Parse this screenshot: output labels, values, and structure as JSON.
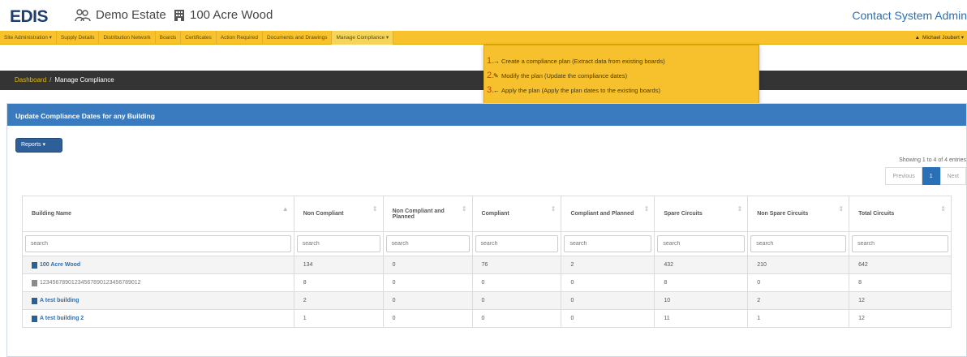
{
  "header": {
    "logo": {
      "first": "E",
      "rest": "DIS"
    },
    "estate_label": "Demo Estate",
    "site_label": "100 Acre Wood",
    "contact_label": "Contact System Admin"
  },
  "nav": {
    "items": [
      {
        "label": "Site Administration ▾"
      },
      {
        "label": "Supply Details"
      },
      {
        "label": "Distribution Network"
      },
      {
        "label": "Boards"
      },
      {
        "label": "Certificates"
      },
      {
        "label": "Action Required"
      },
      {
        "label": "Documents and Drawings"
      },
      {
        "label": "Manage Compliance ▾"
      }
    ],
    "user_label": "Michael Joubert ▾"
  },
  "dropdown": {
    "items": [
      {
        "num": "1.",
        "icon": "→",
        "label": "Create a compliance plan (Extract data from existing boards)"
      },
      {
        "num": "2.",
        "icon": "✎",
        "label": "Modify the plan (Update the compliance dates)"
      },
      {
        "num": "3.",
        "icon": "←",
        "label": "Apply the plan (Apply the plan dates to the existing boards)"
      }
    ]
  },
  "breadcrumb": {
    "home": "Dashboard",
    "separator": "/",
    "current": "Manage Compliance"
  },
  "panel": {
    "title": "Update Compliance Dates for any Building",
    "reports_label": "Reports ▾",
    "showing_text": "Showing 1 to 4 of 4 entries",
    "pager": {
      "prev": "Previous",
      "page": "1",
      "next": "Next"
    }
  },
  "table": {
    "columns": [
      "Building Name",
      "Non Compliant",
      "Non Compliant and Planned",
      "Compliant",
      "Compliant and Planned",
      "Spare Circuits",
      "Non Spare Circuits",
      "Total Circuits"
    ],
    "filter_placeholder": "search",
    "rows": [
      {
        "name": "100 Acre Wood",
        "link": true,
        "values": [
          "134",
          "0",
          "76",
          "2",
          "432",
          "210",
          "642"
        ]
      },
      {
        "name": "12345678901234567890123456789012",
        "link": false,
        "values": [
          "8",
          "0",
          "0",
          "0",
          "8",
          "0",
          "8"
        ]
      },
      {
        "name": "A test building",
        "link": true,
        "values": [
          "2",
          "0",
          "0",
          "0",
          "10",
          "2",
          "12"
        ]
      },
      {
        "name": "A test building 2",
        "link": true,
        "values": [
          "1",
          "0",
          "0",
          "0",
          "11",
          "1",
          "12"
        ]
      }
    ]
  },
  "colors": {
    "nav_bg": "#f7c22c",
    "breadcrumb_bg": "#343434",
    "panel_header": "#3a7bbf",
    "link": "#2a6fb5",
    "non_compliant": "#c9302c"
  }
}
